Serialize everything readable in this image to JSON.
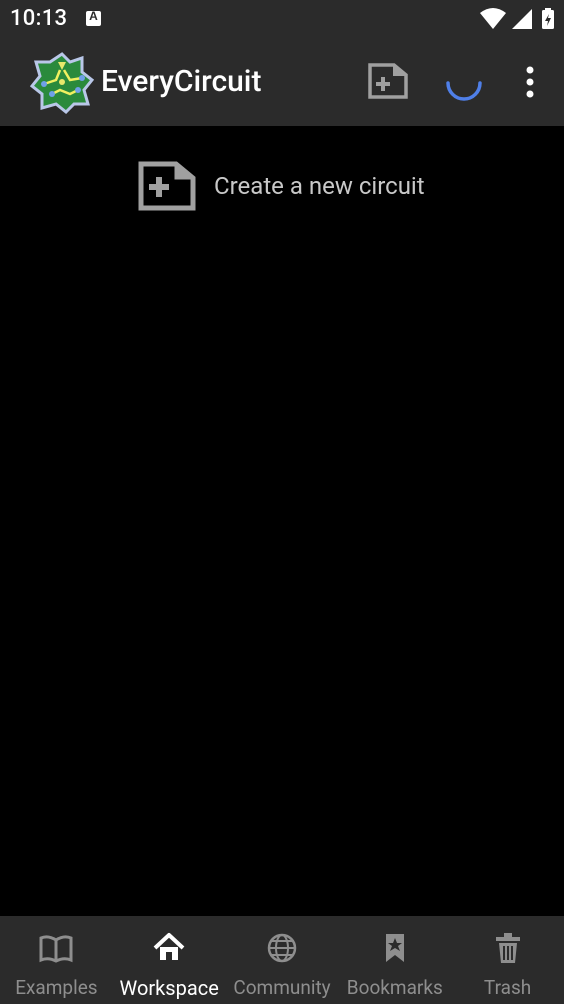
{
  "status_bar": {
    "time": "10:13",
    "notification_icon": "A"
  },
  "app_bar": {
    "title": "EveryCircuit",
    "logo": "everycircuit-logo",
    "actions": [
      {
        "icon": "new-circuit-icon"
      },
      {
        "icon": "loading-spinner"
      },
      {
        "icon": "more-vert-icon"
      }
    ]
  },
  "main": {
    "create_label": "Create a new circuit"
  },
  "bottom_nav": {
    "items": [
      {
        "label": "Examples",
        "icon": "book-icon",
        "active": false
      },
      {
        "label": "Workspace",
        "icon": "home-icon",
        "active": true
      },
      {
        "label": "Community",
        "icon": "globe-icon",
        "active": false
      },
      {
        "label": "Bookmarks",
        "icon": "bookmark-icon",
        "active": false
      },
      {
        "label": "Trash",
        "icon": "trash-icon",
        "active": false
      }
    ]
  },
  "colors": {
    "bar_background": "#2b2b2b",
    "content_background": "#000000",
    "spinner": "#4f7fe8",
    "inactive_nav": "#8e8e8e",
    "active_nav": "#ffffff",
    "icon_gray": "#a0a0a0"
  }
}
